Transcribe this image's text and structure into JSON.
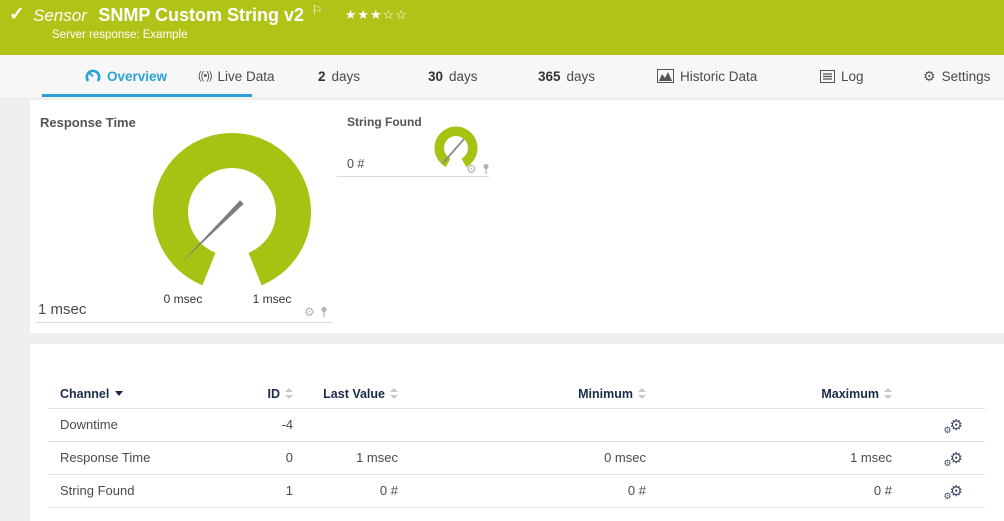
{
  "colors": {
    "brand_green": "#b2c318",
    "gauge_green": "#a6c313",
    "active_tab_blue": "#2aa2d8",
    "table_header_navy": "#1a2b49"
  },
  "header": {
    "check_glyph": "✓",
    "kind_label": "Sensor",
    "title": "SNMP Custom String v2",
    "flag_glyph": "⚐",
    "rating_display": "★★★☆☆",
    "subtitle": "Server response: Example"
  },
  "tabs": [
    {
      "label": "Overview"
    },
    {
      "label": "Live Data"
    },
    {
      "num": "2",
      "label": "days"
    },
    {
      "num": "30",
      "label": "days"
    },
    {
      "num": "365",
      "label": "days"
    },
    {
      "label": "Historic Data"
    },
    {
      "label": "Log"
    },
    {
      "label": "Settings"
    }
  ],
  "icons": {
    "gear": "⚙",
    "broadcast": "((•))"
  },
  "gauges": {
    "response_time": {
      "title": "Response Time",
      "value": "1 msec",
      "scale_min": "0 msec",
      "scale_max": "1 msec"
    },
    "string_found": {
      "title": "String Found",
      "value": "0 #"
    }
  },
  "table": {
    "headers": {
      "channel": "Channel",
      "id": "ID",
      "last_value": "Last Value",
      "minimum": "Minimum",
      "maximum": "Maximum"
    },
    "rows": [
      {
        "channel": "Downtime",
        "id": "-4",
        "last_value": "",
        "minimum": "",
        "maximum": ""
      },
      {
        "channel": "Response Time",
        "id": "0",
        "last_value": "1 msec",
        "minimum": "0 msec",
        "maximum": "1 msec"
      },
      {
        "channel": "String Found",
        "id": "1",
        "last_value": "0 #",
        "minimum": "0 #",
        "maximum": "0 #"
      }
    ]
  }
}
